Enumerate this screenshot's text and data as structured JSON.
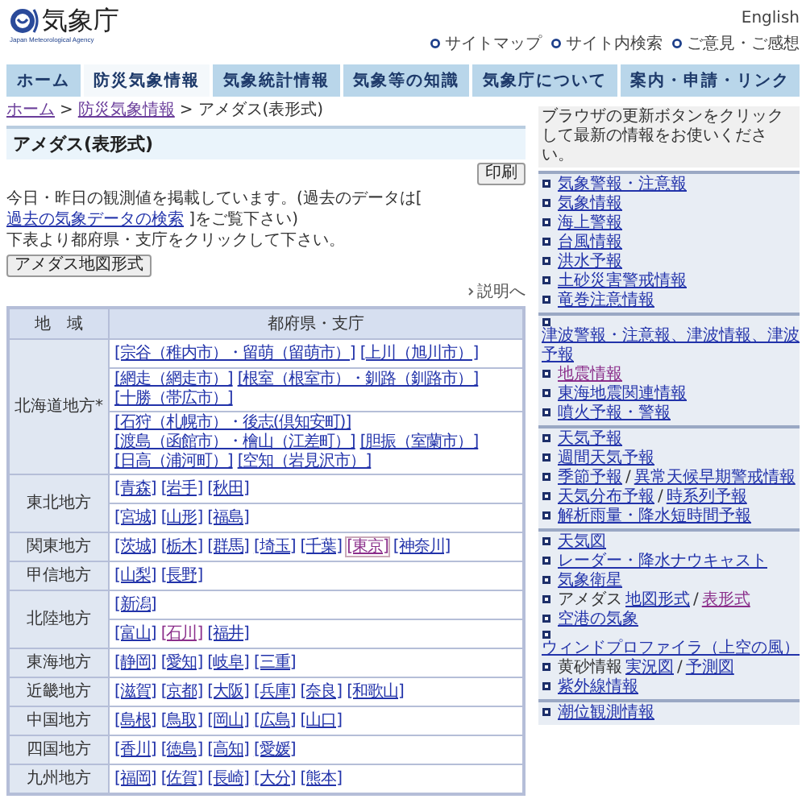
{
  "header": {
    "logo_text": "気象庁",
    "logo_subtitle": "Japan Meteorological Agency",
    "language_link": "English",
    "utility_links": [
      "サイトマップ",
      "サイト内検索",
      "ご意見・ご感想"
    ]
  },
  "nav": [
    {
      "label": "ホーム",
      "selected": false
    },
    {
      "label": "防災気象情報",
      "selected": true
    },
    {
      "label": "気象統計情報",
      "selected": false
    },
    {
      "label": "気象等の知識",
      "selected": false
    },
    {
      "label": "気象庁について",
      "selected": false
    },
    {
      "label": "案内・申請・リンク",
      "selected": false
    }
  ],
  "breadcrumb": [
    {
      "label": "ホーム",
      "kind": "link"
    },
    {
      "label": "防災気象情報",
      "kind": "link"
    },
    {
      "label": "アメダス(表形式)",
      "kind": "plain"
    }
  ],
  "separator": ">",
  "title": "アメダス(表形式)",
  "print_button": "印刷",
  "intro": {
    "before": "今日・昨日の観測値を掲載しています。(過去のデータは[ ",
    "link": "過去の気象データの検索",
    "after": " ]をご覧下さい)"
  },
  "instruction": "下表より都府県・支庁をクリックして下さい。",
  "map_button": "アメダス地図形式",
  "help_link": "説明へ",
  "table": {
    "columns": [
      "地　域",
      "都府県・支庁"
    ],
    "regions": [
      {
        "name": "北海道地方*",
        "cells": [
          [
            [
              {
                "label": "[宗谷（稚内市）・留萌（留萌市）]",
                "visited": false
              },
              {
                "label": "[上川（旭川市）]",
                "visited": false
              }
            ]
          ],
          [
            [
              {
                "label": "[網走（網走市）]",
                "visited": false
              },
              {
                "label": "[根室（根室市）・釧路（釧路市）]",
                "visited": false
              },
              {
                "label": "[十勝（帯広市）]",
                "visited": false
              }
            ]
          ],
          [
            [
              {
                "label": "[石狩（札幌市）・後志(倶知安町)]",
                "visited": false
              },
              {
                "label": "[渡島（函館市）・檜山（江差町）]",
                "visited": false
              },
              {
                "label": "[胆振（室蘭市）]",
                "visited": false
              }
            ],
            [
              {
                "label": "[日高（浦河町）]",
                "visited": false
              },
              {
                "label": "[空知（岩見沢市）]",
                "visited": false
              }
            ]
          ]
        ]
      },
      {
        "name": "東北地方",
        "cells": [
          [
            [
              {
                "label": "[青森]",
                "visited": false
              },
              {
                "label": "[岩手]",
                "visited": false
              },
              {
                "label": "[秋田]",
                "visited": false
              }
            ]
          ],
          [
            [
              {
                "label": "[宮城]",
                "visited": false
              },
              {
                "label": "[山形]",
                "visited": false
              },
              {
                "label": "[福島]",
                "visited": false
              }
            ]
          ]
        ]
      },
      {
        "name": "関東地方",
        "cells": [
          [
            [
              {
                "label": "[茨城]",
                "visited": false
              },
              {
                "label": "[栃木]",
                "visited": false
              },
              {
                "label": "[群馬]",
                "visited": false
              },
              {
                "label": "[埼玉]",
                "visited": false
              },
              {
                "label": "[千葉]",
                "visited": false
              },
              {
                "label": "[東京]",
                "visited": true,
                "focused": true
              },
              {
                "label": "[神奈川]",
                "visited": false
              }
            ]
          ]
        ]
      },
      {
        "name": "甲信地方",
        "cells": [
          [
            [
              {
                "label": "[山梨]",
                "visited": false
              },
              {
                "label": "[長野]",
                "visited": false
              }
            ]
          ]
        ]
      },
      {
        "name": "北陸地方",
        "cells": [
          [
            [
              {
                "label": "[新潟]",
                "visited": false
              }
            ]
          ],
          [
            [
              {
                "label": "[富山]",
                "visited": false
              },
              {
                "label": "[石川]",
                "visited": true
              },
              {
                "label": "[福井]",
                "visited": false
              }
            ]
          ]
        ]
      },
      {
        "name": "東海地方",
        "cells": [
          [
            [
              {
                "label": "[静岡]",
                "visited": false
              },
              {
                "label": "[愛知]",
                "visited": false
              },
              {
                "label": "[岐阜]",
                "visited": false
              },
              {
                "label": "[三重]",
                "visited": false
              }
            ]
          ]
        ]
      },
      {
        "name": "近畿地方",
        "cells": [
          [
            [
              {
                "label": "[滋賀]",
                "visited": false
              },
              {
                "label": "[京都]",
                "visited": false
              },
              {
                "label": "[大阪]",
                "visited": false
              },
              {
                "label": "[兵庫]",
                "visited": false
              },
              {
                "label": "[奈良]",
                "visited": false
              },
              {
                "label": "[和歌山]",
                "visited": false
              }
            ]
          ]
        ]
      },
      {
        "name": "中国地方",
        "cells": [
          [
            [
              {
                "label": "[島根]",
                "visited": false
              },
              {
                "label": "[鳥取]",
                "visited": false
              },
              {
                "label": "[岡山]",
                "visited": false
              },
              {
                "label": "[広島]",
                "visited": false
              },
              {
                "label": "[山口]",
                "visited": false
              }
            ]
          ]
        ]
      },
      {
        "name": "四国地方",
        "cells": [
          [
            [
              {
                "label": "[香川]",
                "visited": false
              },
              {
                "label": "[徳島]",
                "visited": false
              },
              {
                "label": "[高知]",
                "visited": false
              },
              {
                "label": "[愛媛]",
                "visited": false
              }
            ]
          ]
        ]
      },
      {
        "name": "九州地方",
        "cells": [
          [
            [
              {
                "label": "[福岡]",
                "visited": false
              },
              {
                "label": "[佐賀]",
                "visited": false
              },
              {
                "label": "[長崎]",
                "visited": false
              },
              {
                "label": "[大分]",
                "visited": false
              },
              {
                "label": "[熊本]",
                "visited": false
              }
            ]
          ]
        ]
      }
    ]
  },
  "sidebar": {
    "notice": "ブラウザの更新ボタンをクリックして最新の情報をお使いください。",
    "groups": [
      [
        {
          "parts": [
            {
              "text": "気象警報・注意報",
              "kind": "link",
              "visited": false
            }
          ]
        },
        {
          "parts": [
            {
              "text": "気象情報",
              "kind": "link",
              "visited": false
            }
          ]
        },
        {
          "parts": [
            {
              "text": "海上警報",
              "kind": "link",
              "visited": false
            }
          ]
        },
        {
          "parts": [
            {
              "text": "台風情報",
              "kind": "link",
              "visited": false
            }
          ]
        },
        {
          "parts": [
            {
              "text": "洪水予報",
              "kind": "link",
              "visited": false
            }
          ]
        },
        {
          "parts": [
            {
              "text": "土砂災害警戒情報",
              "kind": "link",
              "visited": false
            }
          ]
        },
        {
          "parts": [
            {
              "text": "竜巻注意情報",
              "kind": "link",
              "visited": false
            }
          ]
        }
      ],
      [
        {
          "parts": [
            {
              "text": "津波警報・注意報、津波情報、津波予報",
              "kind": "link",
              "visited": false
            }
          ]
        },
        {
          "parts": [
            {
              "text": "地震情報",
              "kind": "link",
              "visited": true
            }
          ]
        },
        {
          "parts": [
            {
              "text": "東海地震関連情報",
              "kind": "link",
              "visited": false
            }
          ]
        },
        {
          "parts": [
            {
              "text": "噴火予報・警報",
              "kind": "link",
              "visited": false
            }
          ]
        }
      ],
      [
        {
          "parts": [
            {
              "text": "天気予報",
              "kind": "link",
              "visited": false
            }
          ]
        },
        {
          "parts": [
            {
              "text": "週間天気予報",
              "kind": "link",
              "visited": false
            }
          ]
        },
        {
          "parts": [
            {
              "text": "季節予報",
              "kind": "link",
              "visited": false
            },
            {
              "text": "/",
              "kind": "plain"
            },
            {
              "text": "異常天候早期警戒情報",
              "kind": "link",
              "visited": false
            }
          ]
        },
        {
          "parts": [
            {
              "text": "天気分布予報",
              "kind": "link",
              "visited": false
            },
            {
              "text": "/",
              "kind": "plain"
            },
            {
              "text": "時系列予報",
              "kind": "link",
              "visited": false
            }
          ]
        },
        {
          "parts": [
            {
              "text": "解析雨量・降水短時間予報",
              "kind": "link",
              "visited": false
            }
          ]
        }
      ],
      [
        {
          "parts": [
            {
              "text": "天気図",
              "kind": "link",
              "visited": false
            }
          ]
        },
        {
          "parts": [
            {
              "text": "レーダー・降水ナウキャスト",
              "kind": "link",
              "visited": false
            }
          ]
        },
        {
          "parts": [
            {
              "text": "気象衛星",
              "kind": "link",
              "visited": false
            }
          ]
        },
        {
          "parts": [
            {
              "text": "アメダス",
              "kind": "plain"
            },
            {
              "text": "地図形式",
              "kind": "link",
              "visited": false
            },
            {
              "text": "/",
              "kind": "plain"
            },
            {
              "text": "表形式",
              "kind": "link",
              "visited": true
            }
          ]
        },
        {
          "parts": [
            {
              "text": "空港の気象",
              "kind": "link",
              "visited": false
            }
          ]
        },
        {
          "parts": [
            {
              "text": "ウィンドプロファイラ（上空の風）",
              "kind": "link",
              "visited": false
            }
          ]
        },
        {
          "parts": [
            {
              "text": "黄砂情報",
              "kind": "plain"
            },
            {
              "text": "実況図",
              "kind": "link",
              "visited": false
            },
            {
              "text": "/",
              "kind": "plain"
            },
            {
              "text": "予測図",
              "kind": "link",
              "visited": false
            }
          ]
        },
        {
          "parts": [
            {
              "text": "紫外線情報",
              "kind": "link",
              "visited": false
            }
          ]
        }
      ],
      [
        {
          "parts": [
            {
              "text": "潮位観測情報",
              "kind": "link",
              "visited": false
            }
          ]
        }
      ]
    ]
  }
}
